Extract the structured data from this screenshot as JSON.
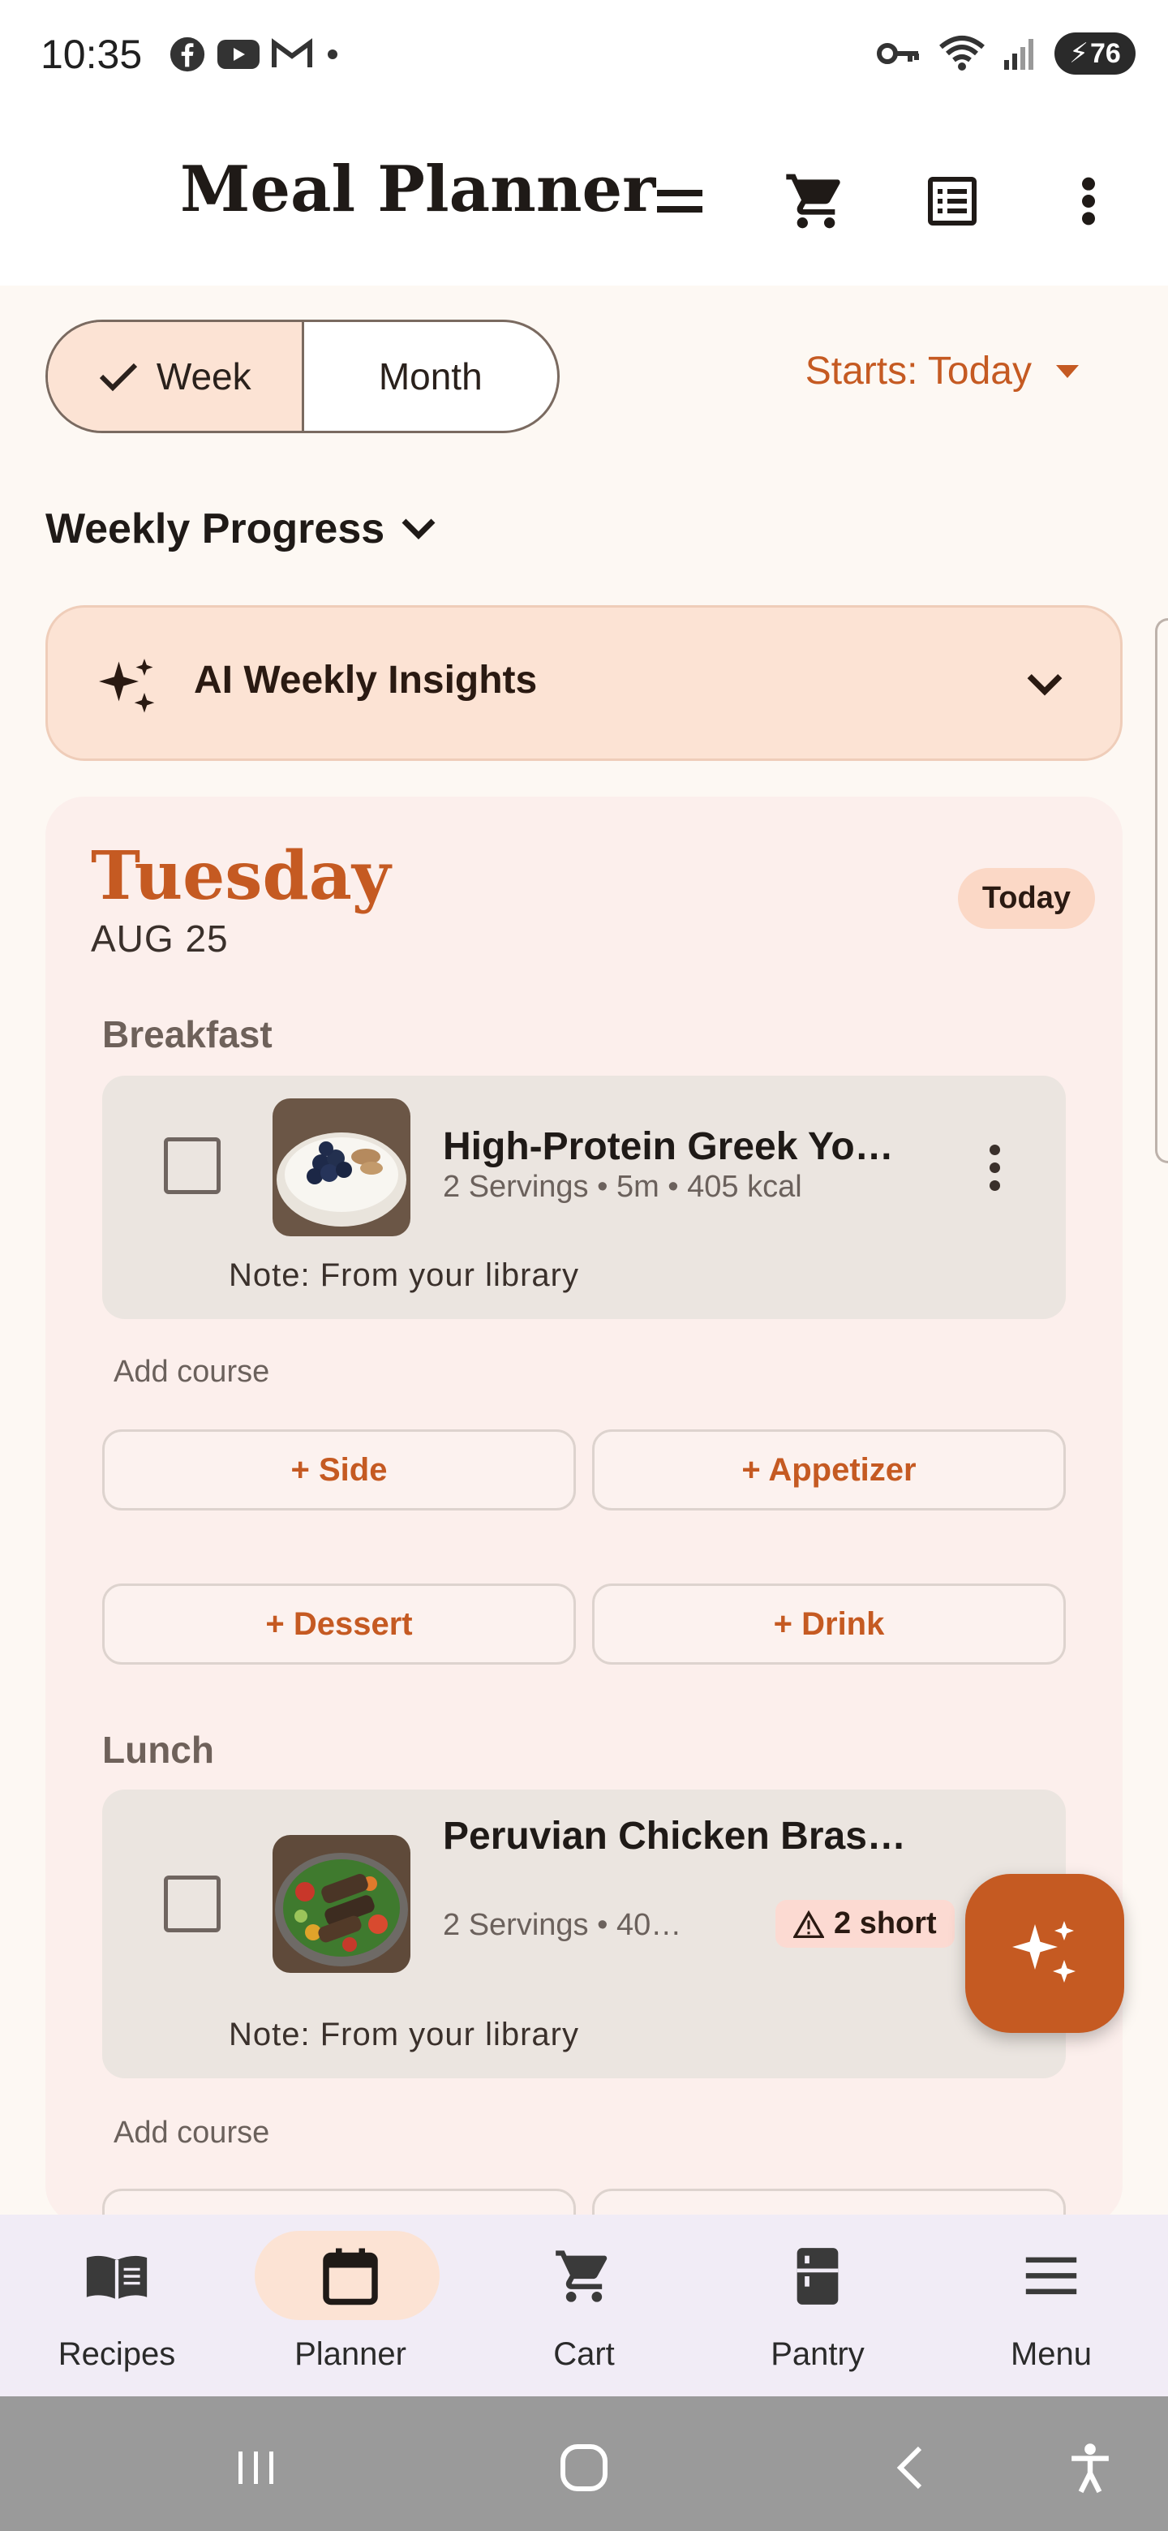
{
  "status_bar": {
    "time": "10:35",
    "battery": "76",
    "left_icons": [
      "facebook-icon",
      "youtube-icon",
      "gmail-icon",
      "dot-icon"
    ],
    "right_icons": [
      "vpn-key-icon",
      "wifi-icon",
      "signal-icon",
      "battery-icon"
    ]
  },
  "appbar": {
    "title": "Meal Planner",
    "icons": [
      "menu-lines-icon",
      "cart-icon",
      "list-icon",
      "more-vert-icon"
    ]
  },
  "view_toggle": {
    "week_label": "Week",
    "month_label": "Month",
    "selected": "Week"
  },
  "starts": {
    "label": "Starts: Today"
  },
  "weekly_progress": {
    "title": "Weekly Progress"
  },
  "insights": {
    "label": "AI Weekly Insights"
  },
  "day": {
    "name": "Tuesday",
    "date": "AUG 25",
    "badge": "Today",
    "meals": [
      {
        "label": "Breakfast",
        "recipe_title": "High-Protein Greek Yo…",
        "meta": "2 Servings • 5m • 405 kcal",
        "note": "Note: From your library",
        "add_course_label": "Add course",
        "course_buttons": [
          "+ Side",
          "+ Appetizer",
          "+ Dessert",
          "+ Drink"
        ]
      },
      {
        "label": "Lunch",
        "recipe_title": "Peruvian Chicken Bras…",
        "meta": "2 Servings • 40…",
        "short_badge": "2 short",
        "note": "Note: From your library",
        "add_course_label": "Add course"
      }
    ]
  },
  "bottom_nav": {
    "items": [
      {
        "label": "Recipes",
        "icon": "book-icon"
      },
      {
        "label": "Planner",
        "icon": "calendar-icon",
        "active": true
      },
      {
        "label": "Cart",
        "icon": "cart-icon"
      },
      {
        "label": "Pantry",
        "icon": "fridge-icon"
      },
      {
        "label": "Menu",
        "icon": "menu-icon"
      }
    ]
  },
  "colors": {
    "accent": "#c55a22",
    "accent_soft": "#fce3d4",
    "background": "#fdf8f3",
    "card": "#ebe5e0"
  }
}
